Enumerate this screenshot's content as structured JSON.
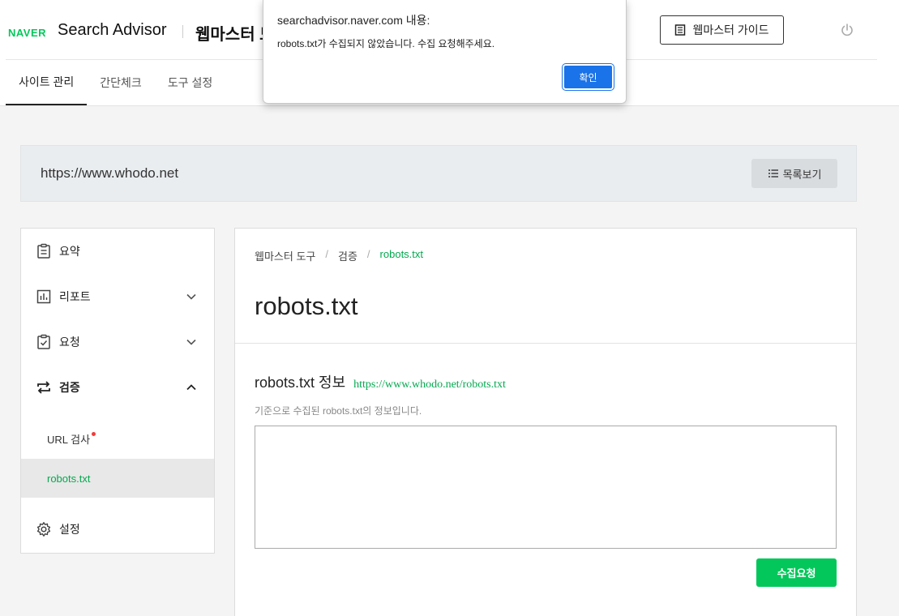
{
  "header": {
    "brand": "NAVER",
    "app_name": "Search Advisor",
    "app_sub": "웹마스터 도",
    "guide_button": "웹마스터 가이드"
  },
  "tabs": [
    {
      "label": "사이트 관리",
      "active": true
    },
    {
      "label": "간단체크",
      "active": false
    },
    {
      "label": "도구 설정",
      "active": false
    }
  ],
  "site": {
    "url": "https://www.whodo.net",
    "list_button": "목록보기"
  },
  "sidebar": {
    "items": [
      {
        "label": "요약",
        "icon": "clipboard-icon"
      },
      {
        "label": "리포트",
        "icon": "bar-chart-icon"
      },
      {
        "label": "요청",
        "icon": "clipboard-check-icon"
      },
      {
        "label": "검증",
        "icon": "repeat-icon"
      },
      {
        "label": "설정",
        "icon": "gear-icon"
      }
    ],
    "sub_items": [
      {
        "label": "URL 검사",
        "badge": true
      },
      {
        "label": "robots.txt",
        "active": true
      }
    ]
  },
  "main": {
    "breadcrumb": [
      "웹마스터 도구",
      "검증",
      "robots.txt"
    ],
    "title": "robots.txt",
    "info_title": "robots.txt 정보",
    "info_link": "https://www.whodo.net/robots.txt",
    "info_desc": "기준으로 수집된 robots.txt의 정보입니다.",
    "robots_content": "",
    "collect_button": "수집요청"
  },
  "dialog": {
    "title": "searchadvisor.naver.com 내용:",
    "message": "robots.txt가 수집되지 않았습니다. 수집 요청해주세요.",
    "ok_button": "확인"
  },
  "colors": {
    "accent_green": "#03c75a",
    "link_green": "#03a94f",
    "dialog_blue": "#1a73e8"
  }
}
